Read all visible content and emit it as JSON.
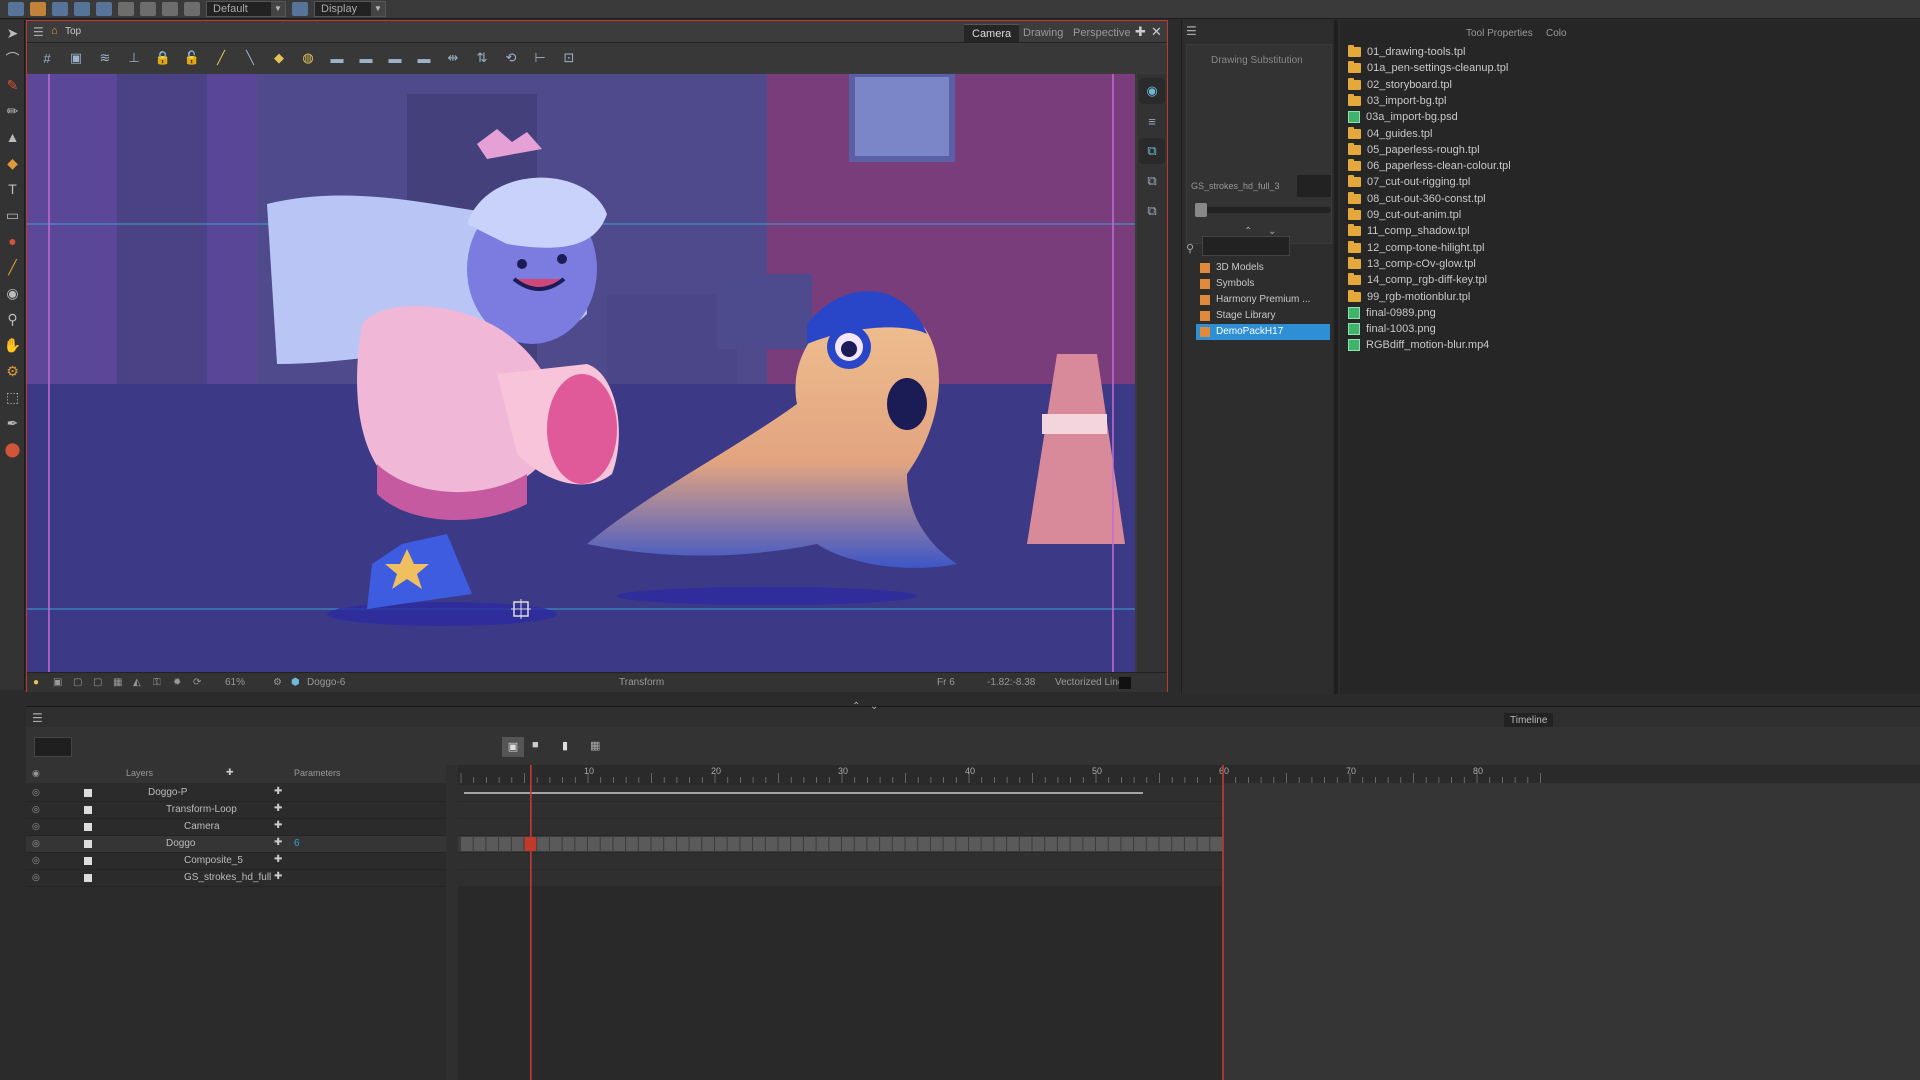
{
  "toolbar": {
    "workspace_combo": "Default",
    "display_combo": "Display"
  },
  "viewport": {
    "breadcrumb": "Top",
    "tabs": [
      "Camera",
      "Drawing",
      "Perspective"
    ],
    "active_tab": "Camera",
    "status": {
      "zoom": "61%",
      "layer": "Doggo-6",
      "mode": "Transform",
      "frame": "Fr 6",
      "coords": "-1.82:-8.38",
      "line_type": "Vectorized Line"
    }
  },
  "drawing_substitution": {
    "title": "Drawing Substitution",
    "drawing_name": "GS_strokes_hd_full_3",
    "tree": [
      {
        "label": "3D Models",
        "selected": false
      },
      {
        "label": "Symbols",
        "selected": false
      },
      {
        "label": "Harmony Premium ...",
        "selected": false
      },
      {
        "label": "Stage Library",
        "selected": false
      },
      {
        "label": "DemoPackH17",
        "selected": true
      }
    ]
  },
  "right_tabs": [
    "Tool Properties",
    "Colo"
  ],
  "files": [
    {
      "name": "01_drawing-tools.tpl",
      "type": "folder"
    },
    {
      "name": "01a_pen-settings-cleanup.tpl",
      "type": "folder"
    },
    {
      "name": "02_storyboard.tpl",
      "type": "folder"
    },
    {
      "name": "03_import-bg.tpl",
      "type": "folder"
    },
    {
      "name": "03a_import-bg.psd",
      "type": "image"
    },
    {
      "name": "04_guides.tpl",
      "type": "folder"
    },
    {
      "name": "05_paperless-rough.tpl",
      "type": "folder"
    },
    {
      "name": "06_paperless-clean-colour.tpl",
      "type": "folder"
    },
    {
      "name": "07_cut-out-rigging.tpl",
      "type": "folder"
    },
    {
      "name": "08_cut-out-360-const.tpl",
      "type": "folder"
    },
    {
      "name": "09_cut-out-anim.tpl",
      "type": "folder"
    },
    {
      "name": "11_comp_shadow.tpl",
      "type": "folder"
    },
    {
      "name": "12_comp-tone-hilight.tpl",
      "type": "folder"
    },
    {
      "name": "13_comp-cOv-glow.tpl",
      "type": "folder"
    },
    {
      "name": "14_comp_rgb-diff-key.tpl",
      "type": "folder"
    },
    {
      "name": "99_rgb-motionblur.tpl",
      "type": "folder"
    },
    {
      "name": "final-0989.png",
      "type": "image"
    },
    {
      "name": "final-1003.png",
      "type": "image"
    },
    {
      "name": "RGBdiff_motion-blur.mp4",
      "type": "image"
    }
  ],
  "timeline": {
    "tab": "Timeline",
    "layers_header": "Layers",
    "parameters_header": "Parameters",
    "layers": [
      {
        "name": "Doggo-P",
        "indent": 0
      },
      {
        "name": "Transform-Loop",
        "indent": 1
      },
      {
        "name": "Camera",
        "indent": 2
      },
      {
        "name": "Doggo",
        "indent": 1,
        "value": "6"
      },
      {
        "name": "Composite_5",
        "indent": 2
      },
      {
        "name": "GS_strokes_hd_full",
        "indent": 2
      }
    ],
    "ruler_labels": [
      "10",
      "20",
      "30",
      "40",
      "50",
      "60",
      "70",
      "80"
    ],
    "current_frame": 6,
    "scene_end": 60
  },
  "colors": {
    "canvas_bg": "#4a3f85",
    "selection": "#3aa0d8",
    "accent_red": "#c0392b",
    "folder": "#e5a83b"
  }
}
